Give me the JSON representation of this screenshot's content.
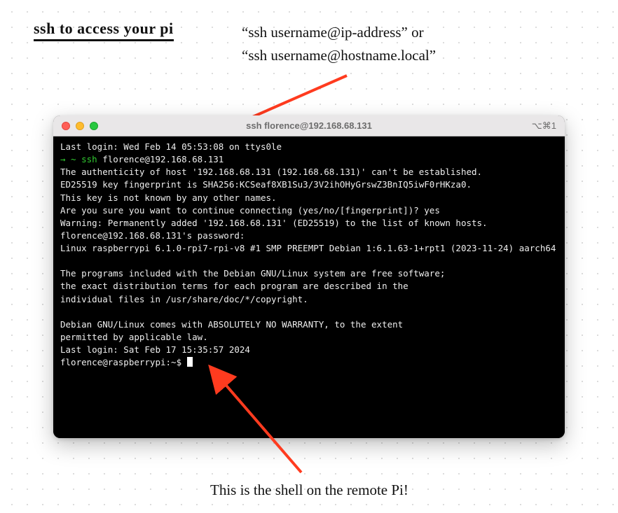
{
  "heading": "ssh to access your pi",
  "annot_top_line1": "“ssh username@ip-address” or",
  "annot_top_line2": "“ssh username@hostname.local”",
  "annot_bottom": "This is the shell on the remote Pi!",
  "terminal": {
    "title": "ssh florence@192.168.68.131",
    "shortcut": "⌥⌘1",
    "last_login_local": "Last login: Wed Feb 14 05:53:08 on ttys0le",
    "prompt_arrow": "→",
    "prompt_tilde": " ~ ",
    "prompt_cmd_ssh": "ssh ",
    "ssh_target": "florence@192.168.68.131",
    "auth_line1": "The authenticity of host '192.168.68.131 (192.168.68.131)' can't be established.",
    "auth_line2": "ED25519 key fingerprint is SHA256:KCSeaf8XB1Su3/3V2ihOHyGrswZ3BnIQ5iwF0rHKza0.",
    "auth_line3": "This key is not known by any other names.",
    "auth_prompt": "Are you sure you want to continue connecting (yes/no/[fingerprint])? yes",
    "warning": "Warning: Permanently added '192.168.68.131' (ED25519) to the list of known hosts.",
    "password_prompt": "florence@192.168.68.131's password:",
    "linux_line": "Linux raspberrypi 6.1.0-rpi7-rpi-v8 #1 SMP PREEMPT Debian 1:6.1.63-1+rpt1 (2023-11-24) aarch64",
    "motd1": "The programs included with the Debian GNU/Linux system are free software;",
    "motd2": "the exact distribution terms for each program are described in the",
    "motd3": "individual files in /usr/share/doc/*/copyright.",
    "motd4": "Debian GNU/Linux comes with ABSOLUTELY NO WARRANTY, to the extent",
    "motd5": "permitted by applicable law.",
    "last_login_remote": "Last login: Sat Feb 17 15:35:57 2024",
    "remote_prompt": "florence@raspberrypi:~$ "
  }
}
